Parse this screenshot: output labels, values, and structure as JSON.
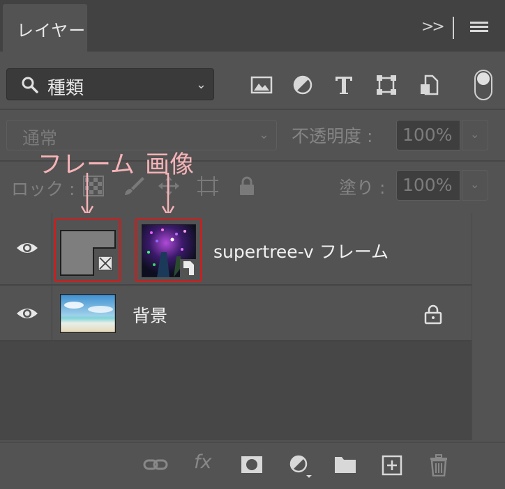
{
  "tab": {
    "label": "レイヤー"
  },
  "header": {
    "expand_label": ">>"
  },
  "filter": {
    "kind_label": "種類"
  },
  "blend": {
    "mode_label": "通常",
    "opacity_label": "不透明度 :",
    "opacity_value": "100%"
  },
  "lock": {
    "label": "ロック :",
    "fill_label": "塗り :",
    "fill_value": "100%"
  },
  "annotations": {
    "frame": "フレーム",
    "image": "画像"
  },
  "layers": [
    {
      "name": "supertree-v フレーム"
    },
    {
      "name": "背景"
    }
  ],
  "footer": {
    "fx_label": "fx"
  },
  "colors": {
    "panel": "#535353",
    "tabbar": "#424242",
    "annotation": "#f6b3b7",
    "highlight_box": "#e01515"
  }
}
